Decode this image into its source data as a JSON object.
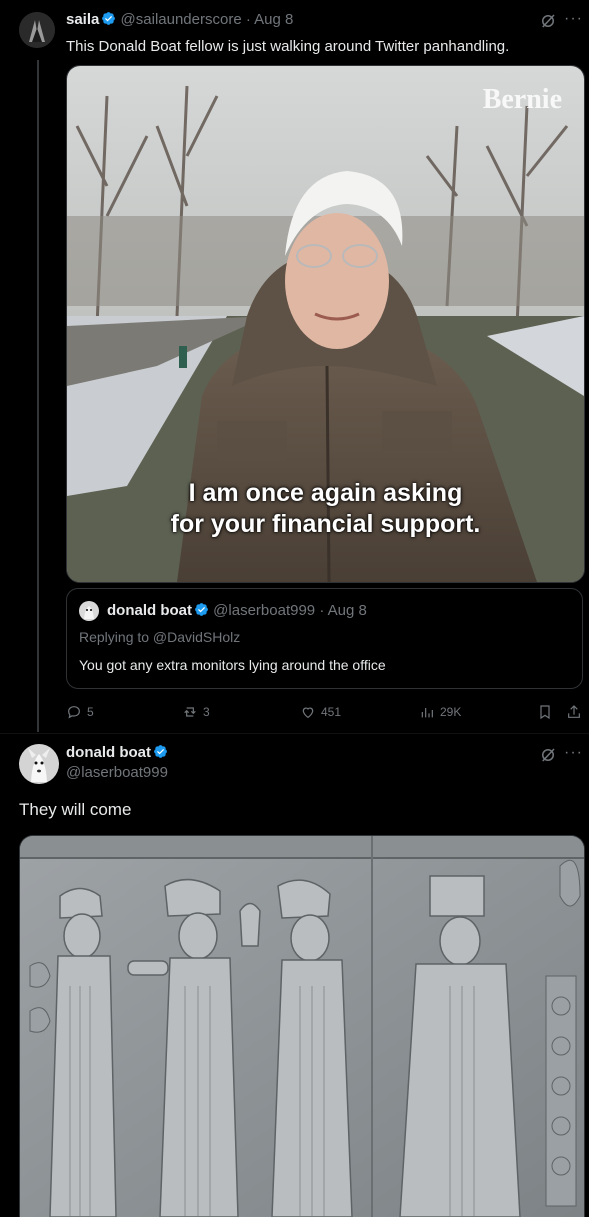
{
  "tweet1": {
    "name": "saila",
    "handle": "@sailaunderscore",
    "date": "· Aug 8",
    "text": "This Donald Boat fellow is just walking around Twitter panhandling.",
    "media": {
      "watermark": "Bernie",
      "caption_line1": "I am once again asking",
      "caption_line2": "for your financial support."
    },
    "quote": {
      "name": "donald boat",
      "handle": "@laserboat999",
      "date": "· Aug 8",
      "replying": "Replying to @DavidSHolz",
      "text": "You got any extra monitors lying around the office"
    },
    "actions": {
      "replies": "5",
      "reposts": "3",
      "likes": "451",
      "views": "29K"
    }
  },
  "tweet2": {
    "name": "donald boat",
    "handle": "@laserboat999",
    "text": "They will come"
  },
  "colors": {
    "verified": "#1d9bf0",
    "muted": "#71767b",
    "text": "#e7e9ea"
  }
}
